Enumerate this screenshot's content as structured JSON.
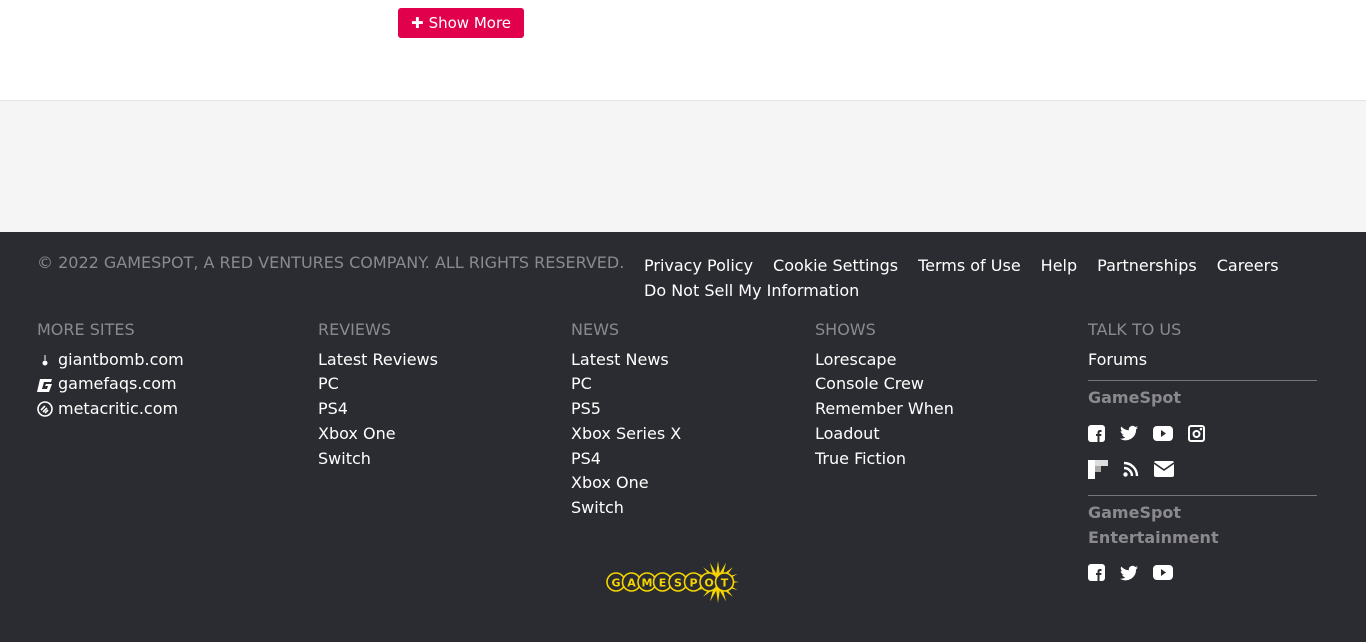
{
  "show_more": {
    "label": "Show More",
    "icon": "plus-icon",
    "color": "#e0004b"
  },
  "footer": {
    "copyright": "© 2022 GAMESPOT, A RED VENTURES COMPANY. ALL RIGHTS RESERVED.",
    "legal_links": [
      "Privacy Policy",
      "Cookie Settings",
      "Terms of Use",
      "Help",
      "Partnerships",
      "Careers",
      "Do Not Sell My Information"
    ],
    "more_sites": {
      "title": "MORE SITES",
      "items": [
        {
          "label": "giantbomb.com",
          "icon": "giantbomb-icon"
        },
        {
          "label": "gamefaqs.com",
          "icon": "gamefaqs-icon"
        },
        {
          "label": "metacritic.com",
          "icon": "metacritic-icon"
        }
      ]
    },
    "reviews": {
      "title": "REVIEWS",
      "items": [
        "Latest Reviews",
        "PC",
        "PS4",
        "Xbox One",
        "Switch"
      ]
    },
    "news": {
      "title": "NEWS",
      "items": [
        "Latest News",
        "PC",
        "PS5",
        "Xbox Series X",
        "PS4",
        "Xbox One",
        "Switch"
      ]
    },
    "shows": {
      "title": "SHOWS",
      "items": [
        "Lorescape",
        "Console Crew",
        "Remember When",
        "Loadout",
        "True Fiction"
      ]
    },
    "talk": {
      "title": "TALK TO US",
      "forums": "Forums",
      "gamespot": "GameSpot",
      "gamespot_ent": "GameSpot Entertainment"
    },
    "logo": "GAMESPOT",
    "logo_color": "#f5d400"
  }
}
